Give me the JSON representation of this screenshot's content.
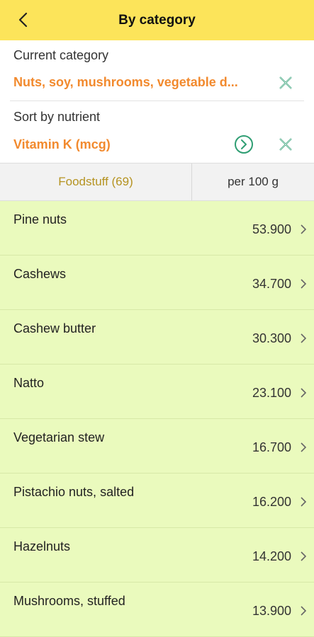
{
  "app_bar": {
    "title": "By category",
    "back_icon": "chevron-left-icon"
  },
  "category": {
    "label": "Current category",
    "value": "Nuts, soy, mushrooms, vegetable d...",
    "clear_icon": "close-x-icon"
  },
  "sort": {
    "label": "Sort by nutrient",
    "value": "Vitamin K (mcg)",
    "go_icon": "chevron-right-circle-icon",
    "clear_icon": "close-x-icon"
  },
  "columns": {
    "food_label": "Foodstuff (69)",
    "per_label": "per 100 g"
  },
  "items": [
    {
      "name": "Pine nuts",
      "value": "53.900"
    },
    {
      "name": "Cashews",
      "value": "34.700"
    },
    {
      "name": "Cashew butter",
      "value": "30.300"
    },
    {
      "name": "Natto",
      "value": "23.100"
    },
    {
      "name": "Vegetarian stew",
      "value": "16.700"
    },
    {
      "name": "Pistachio nuts, salted",
      "value": "16.200"
    },
    {
      "name": "Hazelnuts",
      "value": "14.200"
    },
    {
      "name": "Mushrooms, stuffed",
      "value": "13.900"
    }
  ],
  "colors": {
    "app_bar": "#fce45a",
    "accent_orange": "#f28a2e",
    "icon_green": "#2f9e73",
    "list_bg": "#eafabd",
    "column_gold": "#b59321"
  }
}
